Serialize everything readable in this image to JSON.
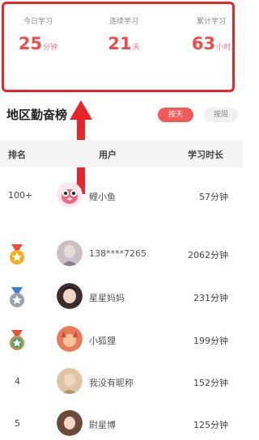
{
  "stats": [
    {
      "label": "今日学习",
      "value": "25",
      "unit": "分钟"
    },
    {
      "label": "连续学习",
      "value": "21",
      "unit": "天"
    },
    {
      "label": "累计学习",
      "value": "63",
      "unit": "小时"
    }
  ],
  "leaderboard": {
    "title": "地区勤奋榜",
    "tab_day": "按天",
    "tab_week": "按周",
    "col_rank": "排名",
    "col_user": "用户",
    "col_time": "学习时长",
    "rows": [
      {
        "rank": "100+",
        "name": "鲤小鱼",
        "time": "57分钟",
        "avatar": "fish-avatar"
      },
      {
        "rank": "",
        "medal": "gold-medal-icon",
        "name": "138****7265",
        "time": "2062分钟",
        "avatar": "user-avatar"
      },
      {
        "rank": "",
        "medal": "silver-medal-icon",
        "name": "星星妈妈",
        "time": "231分钟",
        "avatar": "user-avatar"
      },
      {
        "rank": "",
        "medal": "bronze-medal-icon",
        "name": "小狐狸",
        "time": "199分钟",
        "avatar": "user-avatar"
      },
      {
        "rank": "4",
        "name": "我没有昵称",
        "time": "152分钟",
        "avatar": "user-avatar"
      },
      {
        "rank": "5",
        "name": "尉星博",
        "time": "125分钟",
        "avatar": "user-avatar"
      }
    ]
  },
  "colors": {
    "accent": "#ef4b4b",
    "highlight_border": "#e8252b",
    "gold": "#f2b01e",
    "silver": "#9aa3ad",
    "bronze": "#3aa87a"
  }
}
